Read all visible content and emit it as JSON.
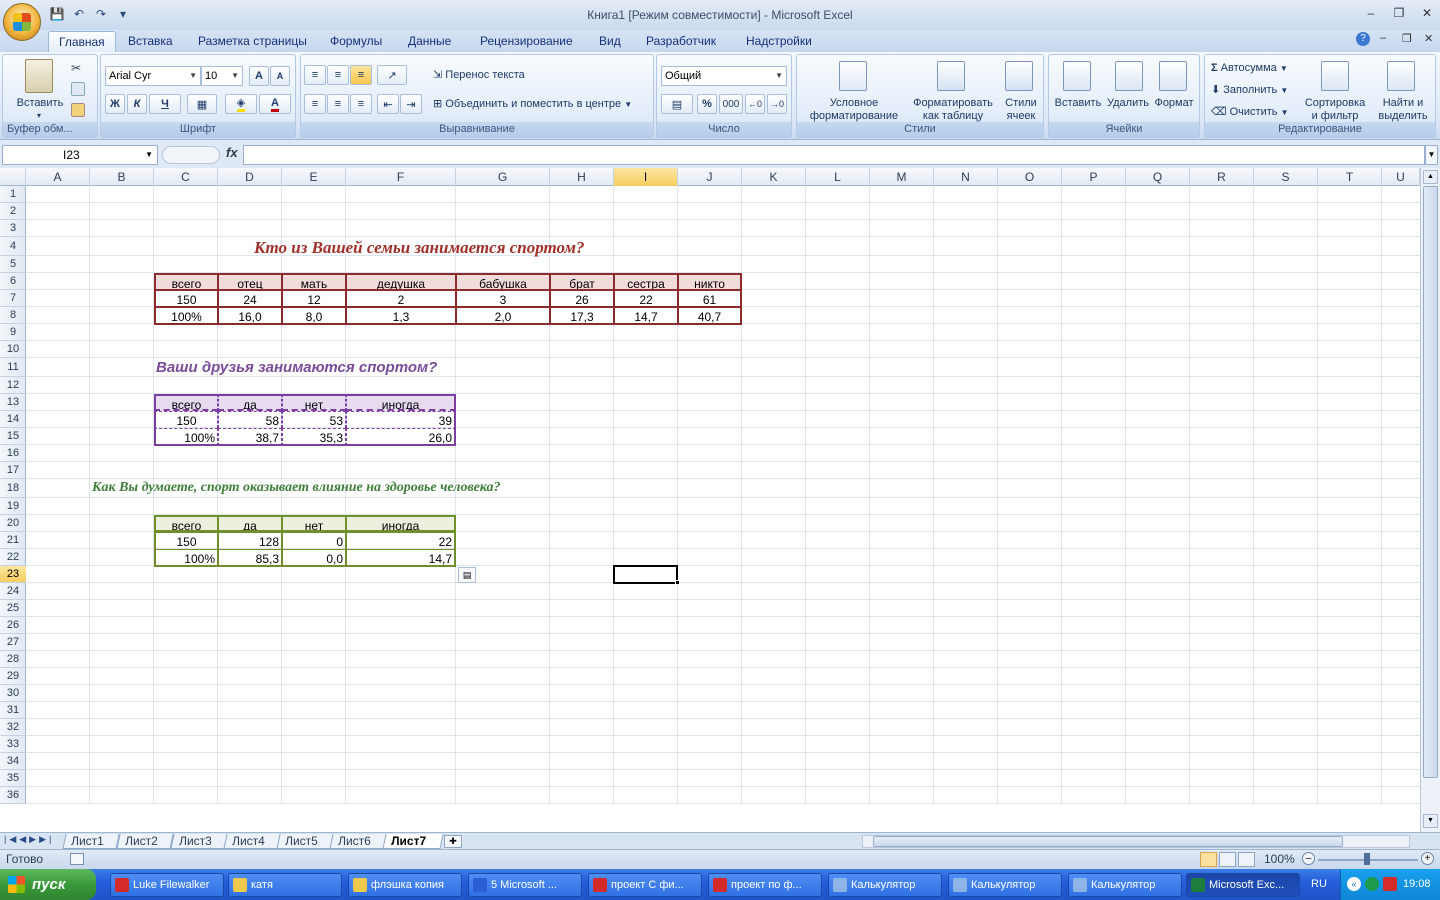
{
  "window": {
    "title": "Книга1  [Режим совместимости] - Microsoft Excel"
  },
  "tabs": [
    "Главная",
    "Вставка",
    "Разметка страницы",
    "Формулы",
    "Данные",
    "Рецензирование",
    "Вид",
    "Разработчик",
    "Надстройки"
  ],
  "ribbon": {
    "clipboard": {
      "label": "Буфер обм...",
      "paste": "Вставить"
    },
    "font": {
      "label": "Шрифт",
      "name": "Arial Cyr",
      "size": "10",
      "bold": "Ж",
      "italic": "К",
      "underline": "Ч",
      "grow": "A",
      "shrink": "A",
      "color": "A"
    },
    "alignment": {
      "label": "Выравнивание",
      "wrap": "Перенос текста",
      "merge": "Объединить и поместить в центре"
    },
    "number": {
      "label": "Число",
      "format": "Общий",
      "percent": "%",
      "thousands": "000"
    },
    "styles": {
      "label": "Стили",
      "conditional": "Условное форматирование",
      "as_table": "Форматировать как таблицу",
      "cell_styles": "Стили ячеек"
    },
    "cells": {
      "label": "Ячейки",
      "insert": "Вставить",
      "delete": "Удалить",
      "format": "Формат"
    },
    "editing": {
      "label": "Редактирование",
      "autosum": "Автосумма",
      "fill": "Заполнить",
      "clear": "Очистить",
      "sort": "Сортировка и фильтр",
      "find": "Найти и выделить"
    }
  },
  "formula": {
    "namebox": "I23",
    "fx": "fx"
  },
  "columns": [
    "A",
    "B",
    "C",
    "D",
    "E",
    "F",
    "G",
    "H",
    "I",
    "J",
    "K",
    "L",
    "M",
    "N",
    "O",
    "P",
    "Q",
    "R",
    "S",
    "T",
    "U"
  ],
  "rows": [
    "1",
    "2",
    "3",
    "4",
    "5",
    "6",
    "7",
    "8",
    "9",
    "10",
    "11",
    "12",
    "13",
    "14",
    "15",
    "16",
    "17",
    "18",
    "19",
    "20",
    "21",
    "22",
    "23",
    "24",
    "25",
    "26",
    "27",
    "28",
    "29",
    "30",
    "31",
    "32",
    "33",
    "34",
    "35",
    "36"
  ],
  "sheet": {
    "title1": "Кто из Вашей семьи занимается спортом?",
    "table1": {
      "headers": [
        "всего",
        "отец",
        "мать",
        "дедушка",
        "бабушка",
        "брат",
        "сестра",
        "никто"
      ],
      "counts": [
        "150",
        "24",
        "12",
        "2",
        "3",
        "26",
        "22",
        "61"
      ],
      "percents": [
        "100%",
        "16,0",
        "8,0",
        "1,3",
        "2,0",
        "17,3",
        "14,7",
        "40,7"
      ]
    },
    "title2": "Ваши друзья занимаются спортом?",
    "table2": {
      "headers": [
        "всего",
        "да",
        "нет",
        "иногда"
      ],
      "counts": [
        "150",
        "58",
        "53",
        "39"
      ],
      "percents": [
        "100%",
        "38,7",
        "35,3",
        "26,0"
      ]
    },
    "title3": "Как Вы думаете, спорт оказывает влияние на здоровье человека?",
    "table3": {
      "headers": [
        "всего",
        "да",
        "нет",
        "иногда"
      ],
      "counts": [
        "150",
        "128",
        "0",
        "22"
      ],
      "percents": [
        "100%",
        "85,3",
        "0,0",
        "14,7"
      ]
    }
  },
  "sheet_tabs": [
    "Лист1",
    "Лист2",
    "Лист3",
    "Лист4",
    "Лист5",
    "Лист6",
    "Лист7"
  ],
  "active_sheet": "Лист7",
  "status": {
    "ready": "Готово",
    "zoom": "100%"
  },
  "taskbar": {
    "start": "пуск",
    "items": [
      "Luke Filewalker",
      "катя",
      "флэшка копия",
      "5 Microsoft ...",
      "проект С фи...",
      "проект по ф...",
      "Калькулятор",
      "Калькулятор",
      "Калькулятор",
      "Microsoft Exc..."
    ],
    "lang": "RU",
    "time": "19:08"
  },
  "colors": {
    "table1": "#8b2b2b",
    "table2": "#7a3fa0",
    "table3": "#6f8f2a",
    "title1": "#a0302a",
    "title2": "#7a4c9a",
    "title3": "#3f7f3a"
  }
}
